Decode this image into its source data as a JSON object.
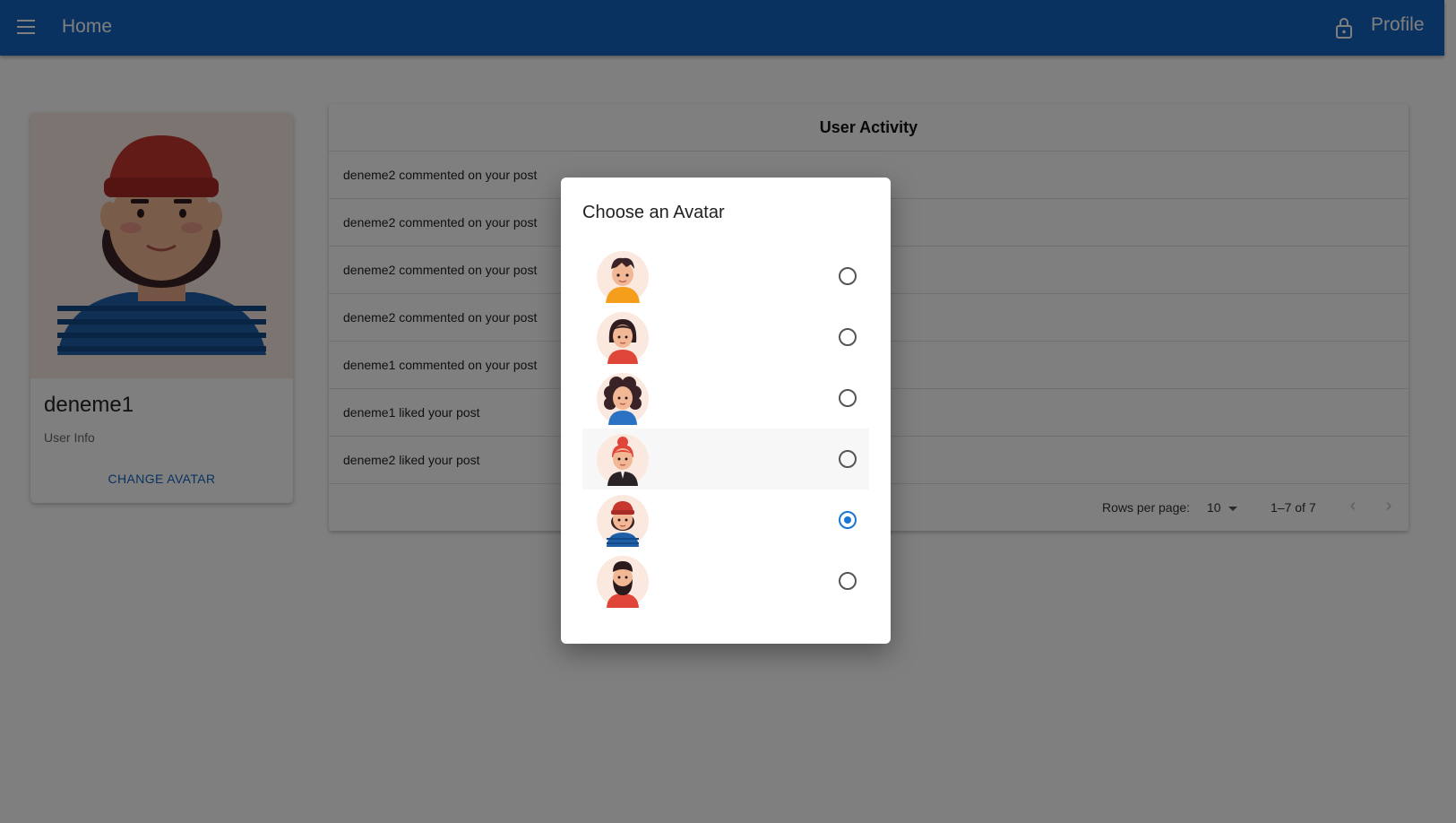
{
  "appbar": {
    "home_label": "Home",
    "profile_label": "Profile",
    "color": "#1565c0"
  },
  "profile_card": {
    "name": "deneme1",
    "subtitle": "User Info",
    "change_avatar_label": "CHANGE AVATAR"
  },
  "activity": {
    "title": "User Activity",
    "rows": [
      "deneme2 commented on your post",
      "deneme2 commented on your post",
      "deneme2 commented on your post",
      "deneme2 commented on your post",
      "deneme1 commented on your post",
      "deneme1 liked your post",
      "deneme2 liked your post"
    ],
    "pagination": {
      "rows_per_page_label": "Rows per page:",
      "rows_per_page_value": "10",
      "range": "1–7 of 7"
    }
  },
  "dialog": {
    "title": "Choose an Avatar",
    "options": [
      {
        "icon": "avatar-orange-hoodie-icon",
        "selected": false
      },
      {
        "icon": "avatar-dark-hair-woman-icon",
        "selected": false
      },
      {
        "icon": "avatar-curly-hair-woman-icon",
        "selected": false
      },
      {
        "icon": "avatar-red-bun-woman-icon",
        "selected": false
      },
      {
        "icon": "avatar-red-beanie-icon",
        "selected": true
      },
      {
        "icon": "avatar-bearded-man-icon",
        "selected": false
      }
    ],
    "selected_color": "#1976d2"
  }
}
